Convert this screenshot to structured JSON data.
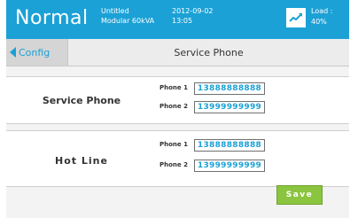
{
  "header": {
    "mode": "Normal",
    "model_line1": "Untitled",
    "model_line2": "Modular 60kVA",
    "date": "2012-09-02",
    "time": "13:05",
    "load_label": "Load :",
    "load_value": "40%",
    "load_icon": "load-monitor-icon"
  },
  "nav": {
    "back_label": "Config",
    "title": "Service Phone"
  },
  "sections": [
    {
      "label": "Service Phone",
      "rows": [
        {
          "label": "Phone 1",
          "value": "13888888888"
        },
        {
          "label": "Phone 2",
          "value": "13999999999"
        }
      ]
    },
    {
      "label": "Hot Line",
      "rows": [
        {
          "label": "Phone 1",
          "value": "13888888888"
        },
        {
          "label": "Phone 2",
          "value": "13999999999"
        }
      ]
    }
  ],
  "save_label": "Save",
  "colors": {
    "accent": "#1ba1d6",
    "save": "#8bc53f"
  }
}
